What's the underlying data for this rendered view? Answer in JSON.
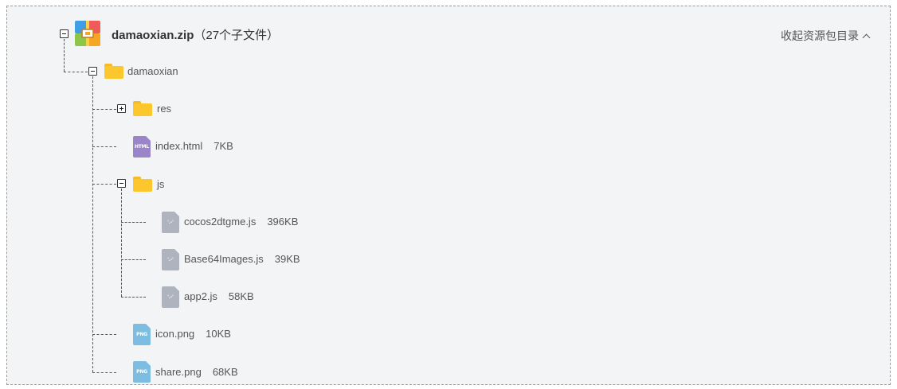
{
  "archive": {
    "name": "damaoxian.zip",
    "count_text": "（27个子文件）",
    "collapse_label": "收起资源包目录"
  },
  "tree": {
    "root_folder": "damaoxian",
    "res_folder": "res",
    "js_folder": "js",
    "files": [
      {
        "name": "index.html",
        "size": "7KB",
        "icon_text": "HTML"
      },
      {
        "name": "cocos2dtgme.js",
        "size": "396KB",
        "icon_text": "'.-'"
      },
      {
        "name": "Base64Images.js",
        "size": "39KB",
        "icon_text": "'.-'"
      },
      {
        "name": "app2.js",
        "size": "58KB",
        "icon_text": "'.-'"
      },
      {
        "name": "icon.png",
        "size": "10KB",
        "icon_text": "PNG"
      },
      {
        "name": "share.png",
        "size": "68KB",
        "icon_text": "PNG"
      }
    ]
  },
  "colors": {
    "panel_bg": "#f3f4f6",
    "folder": "#fcc62d",
    "html_icon": "#9b85c9",
    "js_icon": "#aeb4bd",
    "png_icon": "#7dbde1"
  }
}
